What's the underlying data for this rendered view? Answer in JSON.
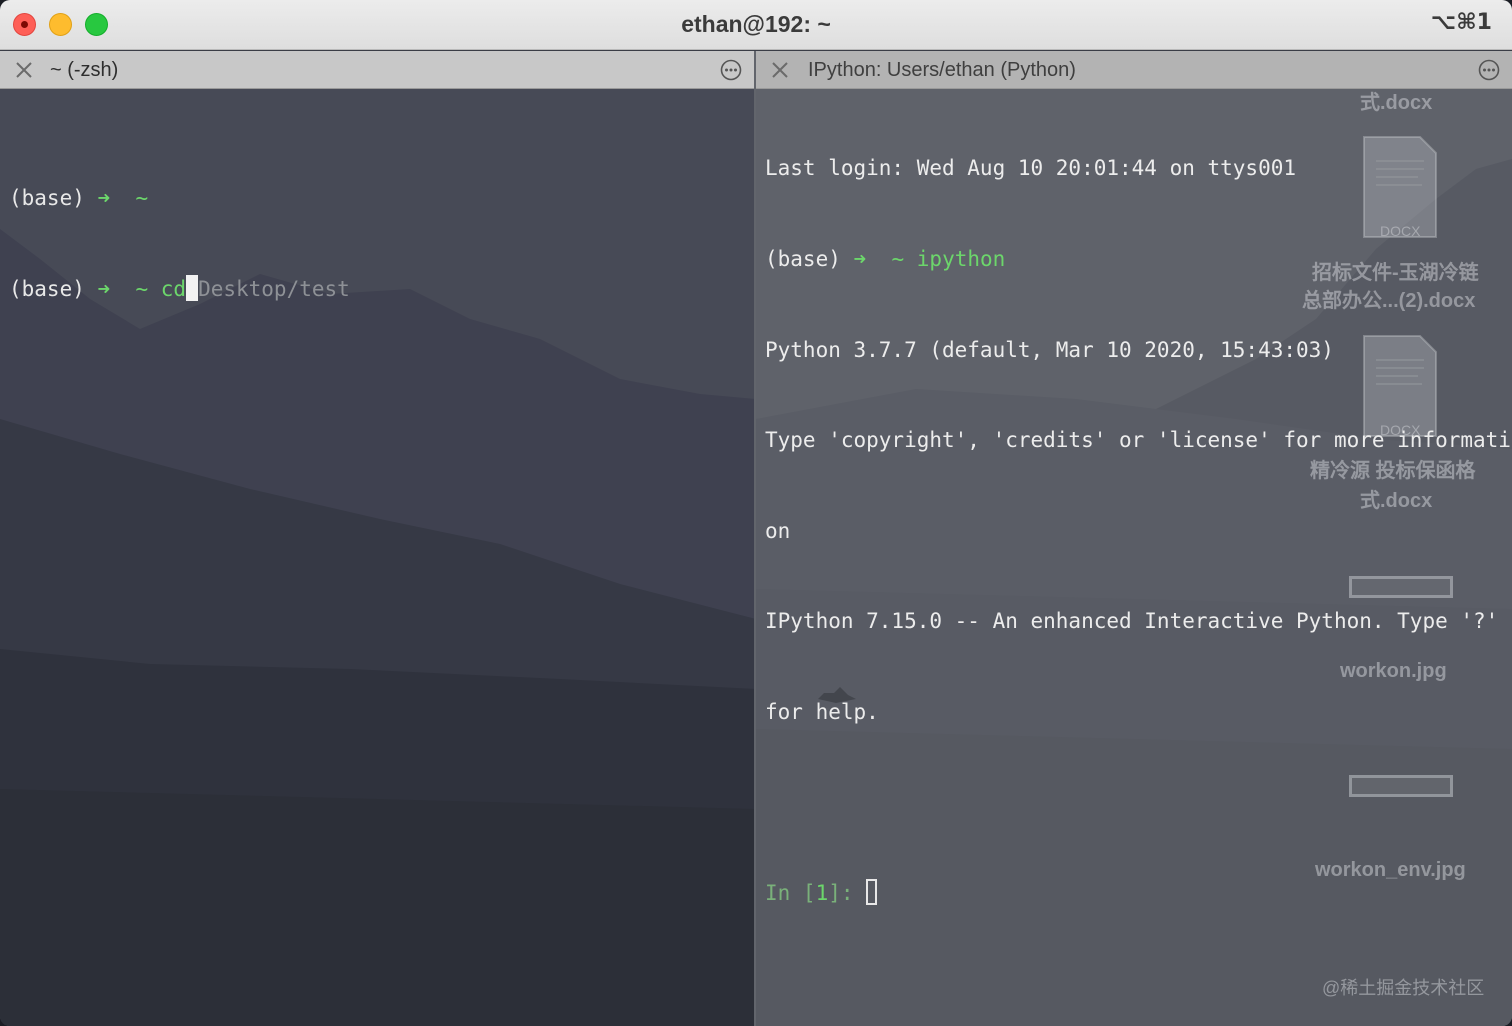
{
  "window": {
    "title": "ethan@192: ~",
    "shortcut": "⌥⌘1"
  },
  "left_pane": {
    "tab_title": "~ (-zsh)",
    "lines": {
      "l1": {
        "prompt": "(base)",
        "arrow": "➜",
        "dir": "~"
      },
      "l2": {
        "prompt": "(base)",
        "arrow": "➜",
        "dir": "~",
        "typed": "cd",
        "suggestion": "Desktop/test"
      }
    }
  },
  "right_pane": {
    "tab_title": "IPython: Users/ethan (Python)",
    "lines": {
      "login": "Last login: Wed Aug 10 20:01:44 on ttys001",
      "cmd_prompt": "(base)",
      "cmd_arrow": "➜",
      "cmd_dir": "~",
      "cmd": "ipython",
      "python_version": "Python 3.7.7 (default, Mar 10 2020, 15:43:03)",
      "type_line_1": "Type 'copyright', 'credits' or 'license' for more informati",
      "type_line_2": "on",
      "ipython_line_1": "IPython 7.15.0 -- An enhanced Interactive Python. Type '?'",
      "ipython_line_2": "for help.",
      "in_prompt_pre": "In [",
      "in_prompt_num": "1",
      "in_prompt_post": "]: "
    }
  },
  "desktop": {
    "item1_label": "式.docx",
    "doc_badge": "DOCX",
    "item2_label_line1": "招标文件-玉湖冷链",
    "item2_label_line2": "总部办公...(2).docx",
    "item3_label_line1": "精冷源 投标保函格",
    "item3_label_line2": "式.docx",
    "item4_label": "workon.jpg",
    "item5_label": "workon_env.jpg",
    "watermark": "@稀土掘金技术社区"
  },
  "colors": {
    "prompt_green": "#6cd66b",
    "close_red": "#fe5f57",
    "minimize_yellow": "#febc2e",
    "zoom_green": "#28c840"
  }
}
